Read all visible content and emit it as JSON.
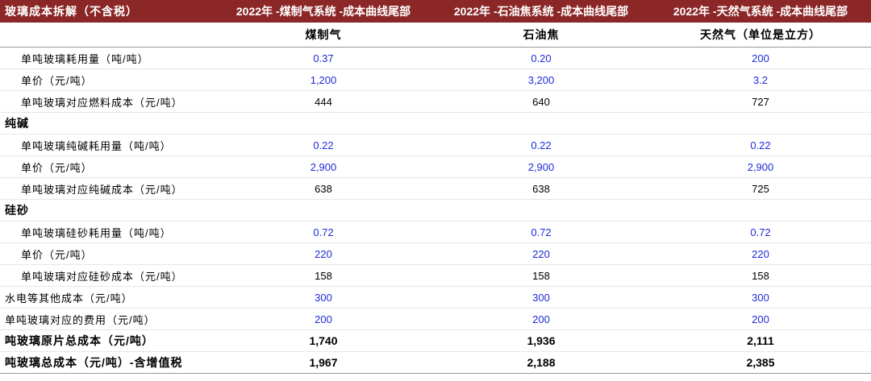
{
  "header": {
    "title": "玻璃成本拆解（不含税）",
    "col1": "2022年 -煤制气系统 -成本曲线尾部",
    "col2": "2022年 -石油焦系统 -成本曲线尾部",
    "col3": "2022年 -天然气系统 -成本曲线尾部"
  },
  "subheader": [
    "煤制气",
    "石油焦",
    "天然气（单位是立方）"
  ],
  "rows": {
    "r0": {
      "label": "单吨玻璃耗用量（吨/吨）",
      "v": [
        "0.37",
        "0.20",
        "200"
      ]
    },
    "r1": {
      "label": "单价（元/吨）",
      "v": [
        "1,200",
        "3,200",
        "3.2"
      ]
    },
    "r2": {
      "label": "单吨玻璃对应燃料成本（元/吨）",
      "v": [
        "444",
        "640",
        "727"
      ]
    },
    "s1": {
      "label": "纯碱"
    },
    "r3": {
      "label": "单吨玻璃纯碱耗用量（吨/吨）",
      "v": [
        "0.22",
        "0.22",
        "0.22"
      ]
    },
    "r4": {
      "label": "单价（元/吨）",
      "v": [
        "2,900",
        "2,900",
        "2,900"
      ]
    },
    "r5": {
      "label": "单吨玻璃对应纯碱成本（元/吨）",
      "v": [
        "638",
        "638",
        "725"
      ]
    },
    "s2": {
      "label": "硅砂"
    },
    "r6": {
      "label": "单吨玻璃硅砂耗用量（吨/吨）",
      "v": [
        "0.72",
        "0.72",
        "0.72"
      ]
    },
    "r7": {
      "label": "单价（元/吨）",
      "v": [
        "220",
        "220",
        "220"
      ]
    },
    "r8": {
      "label": "单吨玻璃对应硅砂成本（元/吨）",
      "v": [
        "158",
        "158",
        "158"
      ]
    },
    "r9": {
      "label": "水电等其他成本（元/吨）",
      "v": [
        "300",
        "300",
        "300"
      ]
    },
    "r10": {
      "label": "单吨玻璃对应的费用（元/吨）",
      "v": [
        "200",
        "200",
        "200"
      ]
    },
    "t1": {
      "label": "吨玻璃原片总成本（元/吨）",
      "v": [
        "1,740",
        "1,936",
        "2,111"
      ]
    },
    "t2": {
      "label": "吨玻璃总成本（元/吨）-含增值税",
      "v": [
        "1,967",
        "2,188",
        "2,385"
      ]
    }
  },
  "colors": {
    "header_bg": "#8c2727",
    "input_blue": "#1d2bd8"
  }
}
